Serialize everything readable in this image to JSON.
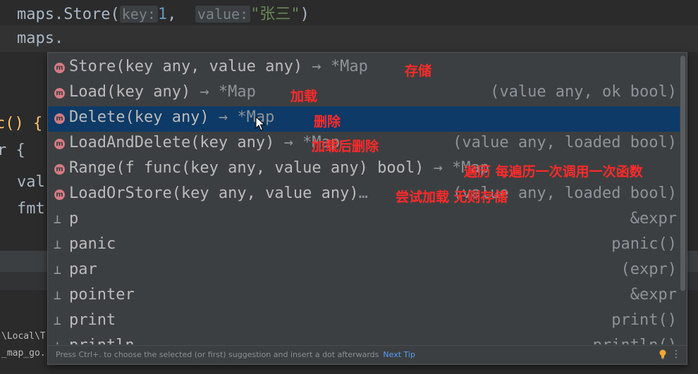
{
  "editor": {
    "line1": {
      "call": "maps.Store(",
      "key_hint": "key:",
      "key_value": "1",
      "comma": ",",
      "value_hint": "value:",
      "value_value": "\"张三\"",
      "close": ")"
    },
    "line2": "maps.",
    "line3": "c() {",
    "line4": "r {",
    "line5": "val",
    "line6": "fmt"
  },
  "terminal": {
    "line1": "\\Local\\T",
    "line2": "_map_go."
  },
  "completion": {
    "items": [
      {
        "kind": "method",
        "badge": "m",
        "name": "Store(key any, value any)",
        "ret": " → *Map",
        "tail": "",
        "note": "存储"
      },
      {
        "kind": "method",
        "badge": "m",
        "name": "Load(key any)",
        "ret": " → *Map",
        "tail": "(value any, ok bool)",
        "note": "加载"
      },
      {
        "kind": "method",
        "badge": "m",
        "name": "Delete(key any)",
        "ret": " → *Map",
        "tail": "",
        "note": "删除"
      },
      {
        "kind": "method",
        "badge": "m",
        "name": "LoadAndDelete(key any)",
        "ret": " → *Map",
        "tail": "(value any, loaded bool)",
        "note": "加载后删除"
      },
      {
        "kind": "method",
        "badge": "m",
        "name": "Range(f func(key any, value any) bool)",
        "ret": " → *Map",
        "tail": "",
        "note": "遍历 每遍历一次调用一次函数"
      },
      {
        "kind": "method",
        "badge": "m",
        "name": "LoadOrStore(key any, value any)",
        "ret": "…",
        "tail": "(value any, loaded bool)",
        "note": "尝试加载 无则存储"
      },
      {
        "kind": "template",
        "badge": "",
        "name": "p",
        "ret": "",
        "tail": "&expr",
        "note": ""
      },
      {
        "kind": "template",
        "badge": "",
        "name": "panic",
        "ret": "",
        "tail": "panic()",
        "note": ""
      },
      {
        "kind": "template",
        "badge": "",
        "name": "par",
        "ret": "",
        "tail": "(expr)",
        "note": ""
      },
      {
        "kind": "template",
        "badge": "",
        "name": "pointer",
        "ret": "",
        "tail": "&expr",
        "note": ""
      },
      {
        "kind": "template",
        "badge": "",
        "name": "print",
        "ret": "",
        "tail": "print()",
        "note": ""
      },
      {
        "kind": "template",
        "badge": "",
        "name": "println",
        "ret": "",
        "tail": "println()",
        "note": ""
      }
    ],
    "selected_index": 2,
    "footer": {
      "text": "Press Ctrl+. to choose the selected (or first) suggestion and insert a dot afterwards",
      "link": "Next Tip"
    }
  },
  "colors": {
    "popup_bg": "#3c3f41",
    "selection": "#0d3a66",
    "annotation": "#ff2a2a",
    "method_badge": "#d67a84",
    "link": "#589df6"
  },
  "icons": {
    "method": "method-icon",
    "template": "live-template-icon",
    "bulb": "lightbulb-icon",
    "menu": "more-options-icon",
    "cursor": "mouse-cursor-icon"
  }
}
